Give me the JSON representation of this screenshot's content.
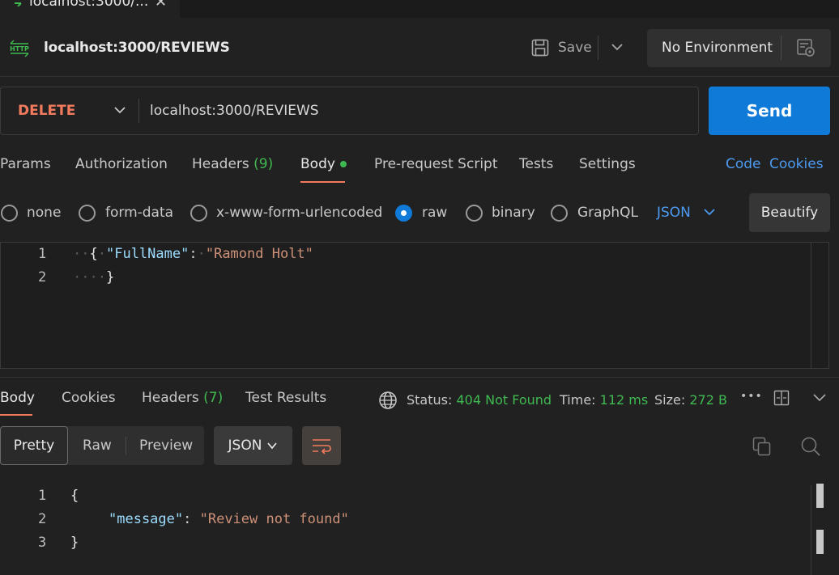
{
  "tab": {
    "title": "localhost:3000/...",
    "close": "✕"
  },
  "request": {
    "title": "localhost:3000/REVIEWS",
    "save_label": "Save",
    "environment": "No Environment",
    "method": "DELETE",
    "url": "localhost:3000/REVIEWS",
    "send_label": "Send"
  },
  "request_tabs": {
    "params": "Params",
    "authorization": "Authorization",
    "headers": "Headers",
    "headers_count": "(9)",
    "body": "Body",
    "pre_request": "Pre-request Script",
    "tests": "Tests",
    "settings": "Settings",
    "code": "Code",
    "cookies": "Cookies"
  },
  "body_types": {
    "none": "none",
    "form_data": "form-data",
    "urlencoded": "x-www-form-urlencoded",
    "raw": "raw",
    "binary": "binary",
    "graphql": "GraphQL",
    "selected": "raw",
    "format": "JSON",
    "beautify": "Beautify"
  },
  "request_body": {
    "line_numbers": [
      "1",
      "2"
    ],
    "key": "\"FullName\"",
    "value": "\"Ramond Holt\""
  },
  "response_tabs": {
    "body": "Body",
    "cookies": "Cookies",
    "headers": "Headers",
    "headers_count": "(7)",
    "test_results": "Test Results"
  },
  "response_meta": {
    "status_label": "Status:",
    "status_value": "404 Not Found",
    "time_label": "Time:",
    "time_value": "112 ms",
    "size_label": "Size:",
    "size_value": "272 B",
    "more": "•••"
  },
  "response_toolbar": {
    "pretty": "Pretty",
    "raw": "Raw",
    "preview": "Preview",
    "format": "JSON"
  },
  "response_body": {
    "line_numbers": [
      "1",
      "2",
      "3"
    ],
    "key": "\"message\"",
    "value": "\"Review not found\""
  },
  "colors": {
    "accent": "#0f7ad8",
    "method": "#f27b5d",
    "success": "#3fb950",
    "link": "#4c9bf0"
  }
}
